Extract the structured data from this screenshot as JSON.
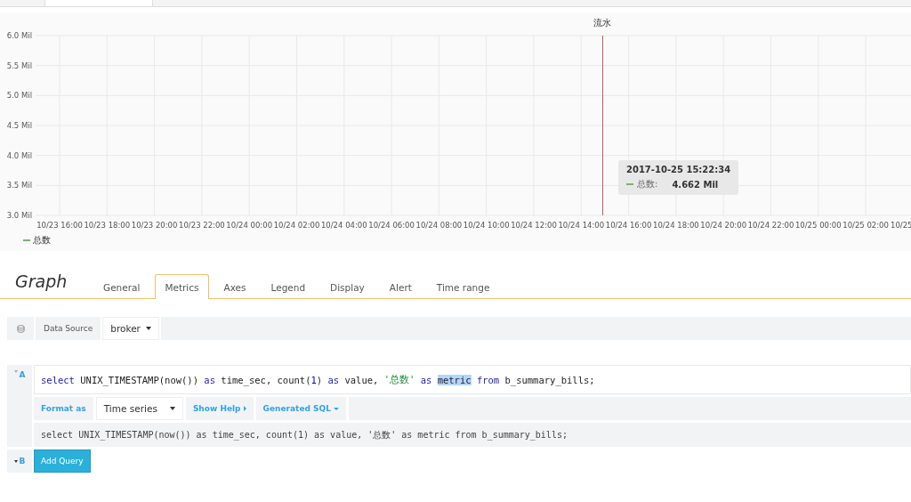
{
  "graph_panel": {
    "chart_data": {
      "type": "line",
      "title": "流水",
      "grid": true,
      "series": [
        {
          "name": "总数",
          "color": "#7eb26d",
          "values": [
            null,
            null,
            null,
            null,
            null,
            null,
            null,
            null,
            null,
            null,
            null,
            null,
            null,
            null,
            null,
            null,
            null,
            null,
            null
          ]
        }
      ],
      "ylim": [
        3,
        6
      ],
      "yticks": [
        {
          "value": 6,
          "label": "6.0 Mil"
        },
        {
          "value": 5.5,
          "label": "5.5 Mil"
        },
        {
          "value": 5,
          "label": "5.0 Mil"
        },
        {
          "value": 4.5,
          "label": "4.5 Mil"
        },
        {
          "value": 4,
          "label": "4.0 Mil"
        },
        {
          "value": 3.5,
          "label": "3.5 Mil"
        },
        {
          "value": 3,
          "label": "3.0 Mil"
        }
      ],
      "categories": [
        "10/23 16:00",
        "10/23 18:00",
        "10/23 20:00",
        "10/23 22:00",
        "10/24 00:00",
        "10/24 02:00",
        "10/24 04:00",
        "10/24 06:00",
        "10/24 08:00",
        "10/24 10:00",
        "10/24 12:00",
        "10/24 14:00",
        "10/24 16:00",
        "10/24 18:00",
        "10/24 20:00",
        "10/24 22:00",
        "10/25 00:00",
        "10/25 02:00",
        "10/25"
      ]
    },
    "tooltip": {
      "time": "2017-10-25 15:22:34",
      "series": "总数:",
      "value": "4.662 Mil"
    }
  },
  "editor": {
    "title": "Graph",
    "tabs": [
      {
        "label": "General",
        "selected": false
      },
      {
        "label": "Metrics",
        "selected": true
      },
      {
        "label": "Axes",
        "selected": false
      },
      {
        "label": "Legend",
        "selected": false
      },
      {
        "label": "Display",
        "selected": false
      },
      {
        "label": "Alert",
        "selected": false
      },
      {
        "label": "Time range",
        "selected": false
      }
    ],
    "data_source": {
      "label": "Data Source",
      "value": "broker"
    },
    "queries": [
      {
        "ref": "A",
        "expanded": true,
        "sql": [
          {
            "kind": "keyword",
            "text": "select"
          },
          {
            "kind": "plain",
            "text": " UNIX_TIMESTAMP(now()) "
          },
          {
            "kind": "keyword",
            "text": "as"
          },
          {
            "kind": "plain",
            "text": " time_sec, count("
          },
          {
            "kind": "number",
            "text": "1"
          },
          {
            "kind": "plain",
            "text": ") "
          },
          {
            "kind": "keyword",
            "text": "as"
          },
          {
            "kind": "plain",
            "text": " value, "
          },
          {
            "kind": "string",
            "text": "'总数'"
          },
          {
            "kind": "keyword",
            "text": " as "
          },
          {
            "kind": "selected",
            "text": "metric"
          },
          {
            "kind": "keyword",
            "text": " from"
          },
          {
            "kind": "plain",
            "text": " b_summary_bills;"
          }
        ],
        "format_label": "Format as",
        "format_value": "Time series",
        "show_help": "Show Help",
        "generated_sql_label": "Generated SQL",
        "generated_sql": "select UNIX_TIMESTAMP(now()) as time_sec, count(1) as value, '总数' as metric from b_summary_bills;"
      },
      {
        "ref": "B",
        "expanded": false,
        "add_button": "Add Query"
      }
    ]
  }
}
